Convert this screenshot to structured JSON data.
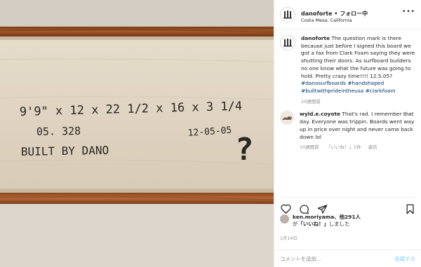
{
  "photo": {
    "line1": "9'9\" x 12 x 22 1/2 x 16 x 3 1/4",
    "line2": "05. 328",
    "line3": "BUILT BY DANO",
    "line4": "12-05-05",
    "mark": "?"
  },
  "header": {
    "username": "danoforte",
    "separator": " • ",
    "follow_label": "フォロー中",
    "location": "Costa Mesa, California",
    "more": "•••"
  },
  "caption": {
    "username": "danoforte",
    "text": "The question mark is there because just before I signed this board we got a fax from Clark Foam saying they were shutting their doors. As surfboard builders no one know what the future was going to hold. Pretty crazy time!!!! 12.5.05?",
    "hashtags": [
      "#danosurfboards",
      "#handshaped",
      "#builtwithprideintheusa",
      "#clarkfoam"
    ],
    "time": "10週間前"
  },
  "comment": {
    "username": "wyld.e.coyote",
    "text": "That's rad. I remember that day. Everyone was trippin. Boards went way up in price over night and never came back down lol",
    "time": "10週間前",
    "likes": "「いいね！」1件",
    "reply": "返信",
    "heart": "♡"
  },
  "likes": {
    "user": "ken.moriyama",
    "others": "、他291人",
    "suffix_pre": "が",
    "suffix_quote": "「いいね！」",
    "suffix_post": "しました"
  },
  "date": "1月14日",
  "add_comment": {
    "placeholder": "コメントを追加...",
    "post_label": "投稿する"
  }
}
